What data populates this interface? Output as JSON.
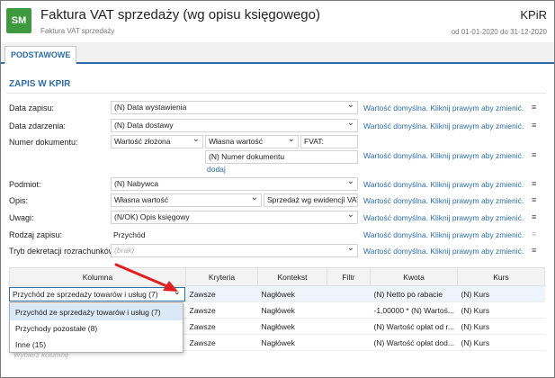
{
  "header": {
    "logo": "SM",
    "title": "Faktura VAT sprzedaży (wg opisu księgowego)",
    "subtitle": "Faktura VAT sprzedaży",
    "module": "KPiR",
    "period": "od 01-01-2020 do 31-12-2020"
  },
  "tabs": [
    {
      "label": "PODSTAWOWE"
    }
  ],
  "section_title": "ZAPIS W KPIR",
  "default_hint": "Wartość domyślna. Kliknij prawym aby zmienić.",
  "menu_icon": "≡",
  "form": {
    "data_zapisu": {
      "label": "Data zapisu:",
      "value": "(N) Data wystawienia"
    },
    "data_zdarzenia": {
      "label": "Data zdarzenia:",
      "value": "(N) Data dostawy"
    },
    "numer_dokumentu": {
      "label": "Numer dokumentu:",
      "part1": "Wartość złożona",
      "part2": "Własna wartość",
      "part3": "FVAT:",
      "part4": "(N) Numer dokumentu",
      "add_link": "dodaj"
    },
    "podmiot": {
      "label": "Podmiot:",
      "value": "(N) Nabywca"
    },
    "opis": {
      "label": "Opis:",
      "value": "Własna wartość",
      "text": "Sprzedaż wg ewidencji VAT"
    },
    "uwagi": {
      "label": "Uwagi:",
      "value": "(N/OK) Opis księgowy"
    },
    "rodzaj_zapisu": {
      "label": "Rodzaj zapisu:",
      "value": "Przychód"
    },
    "tryb": {
      "label": "Tryb dekretacji rozrachunków:",
      "placeholder": "(brak)"
    }
  },
  "table": {
    "headers": [
      "Kolumna",
      "Kryteria",
      "Kontekst",
      "Filtr",
      "Kwota",
      "Kurs"
    ],
    "selected_column": "Przychód ze sprzedaży towarów i usług (7)",
    "rows": [
      {
        "kryteria": "Zawsze",
        "kontekst": "Nagłówek",
        "filtr": "",
        "kwota": "(N) Netto po rabacie",
        "kurs": "(N) Kurs"
      },
      {
        "kryteria": "Zawsze",
        "kontekst": "Nagłówek",
        "filtr": "",
        "kwota": "-1,00000 * (N) Wartoś...",
        "kurs": "(N) Kurs"
      },
      {
        "kryteria": "Zawsze",
        "kontekst": "Nagłówek",
        "filtr": "",
        "kwota": "(N) Wartość opłat od r...",
        "kurs": "(N) Kurs"
      },
      {
        "kryteria": "Zawsze",
        "kontekst": "Nagłówek",
        "filtr": "",
        "kwota": "(N) Wartość opłat dod...",
        "kurs": "(N) Kurs"
      }
    ],
    "dropdown_options": [
      "Przychód ze sprzedaży towarów i usług (7)",
      "Przychody pozostałe (8)",
      "Inne (15)"
    ],
    "add_column_placeholder": "Wybierz kolumnę"
  },
  "colors": {
    "accent": "#2e6da4",
    "logo_bg": "#3f9a3f",
    "arrow": "#e02020"
  }
}
